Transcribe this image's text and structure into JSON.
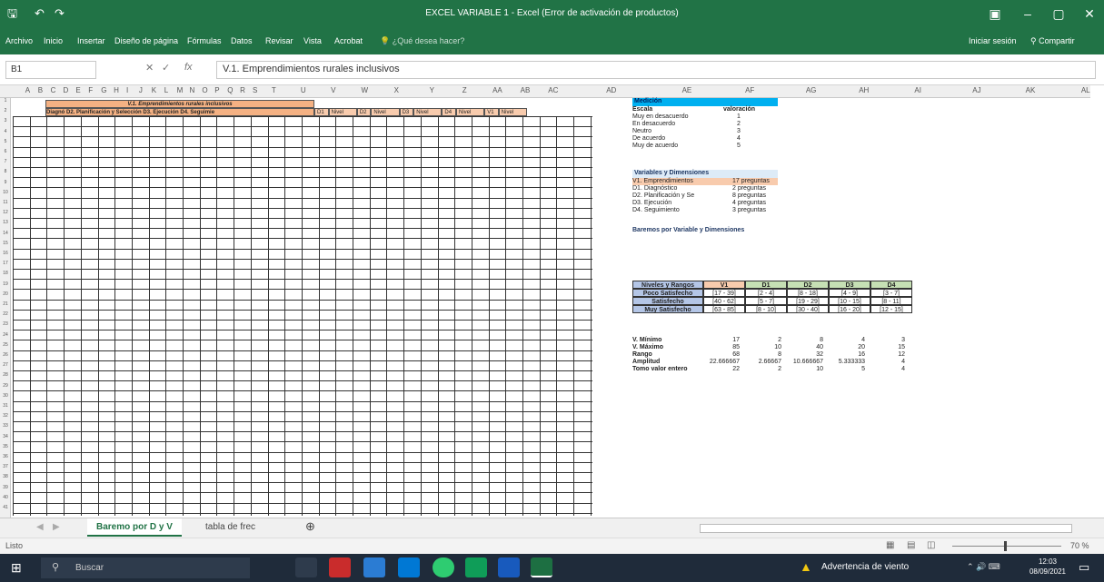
{
  "window": {
    "title": "EXCEL VARIABLE 1 - Excel (Error de activación de productos)"
  },
  "ribbon": {
    "tabs": [
      "Archivo",
      "Inicio",
      "Insertar",
      "Diseño de página",
      "Fórmulas",
      "Datos",
      "Revisar",
      "Vista",
      "Acrobat"
    ],
    "tell_me": "¿Qué desea hacer?",
    "signin": "Iniciar sesión",
    "share": "Compartir"
  },
  "formula_bar": {
    "name_box": "B1",
    "fx": "fx",
    "value": "V.1. Emprendimientos rurales inclusivos"
  },
  "columns": [
    "A",
    "B",
    "C",
    "D",
    "E",
    "F",
    "G",
    "H",
    "I",
    "J",
    "K",
    "L",
    "M",
    "N",
    "O",
    "P",
    "Q",
    "R",
    "S",
    "T",
    "U",
    "V",
    "W",
    "X",
    "Y",
    "Z",
    "AA",
    "AB",
    "AC",
    "AD",
    "AE",
    "AF",
    "AG",
    "AH",
    "AI",
    "AJ",
    "AK",
    "AL"
  ],
  "sheet": {
    "title_row": "V.1. Emprendimientos rurales inclusivos",
    "dimension_row": "Diagnó D2. Planificación y Selección D3. Ejecución D4. Seguimie",
    "right_headers": [
      "D1",
      "Nivel",
      "D2",
      "Nivel",
      "D3",
      "Nivel",
      "D4",
      "Nivel",
      "V1",
      "Nivel"
    ]
  },
  "medicion": {
    "title": "Medición",
    "header_left": "Escala",
    "header_right": "valoración",
    "rows": [
      {
        "label": "Muy en desacuerdo",
        "value": "1"
      },
      {
        "label": "En desacuerdo",
        "value": "2"
      },
      {
        "label": "Neutro",
        "value": "3"
      },
      {
        "label": "De acuerdo",
        "value": "4"
      },
      {
        "label": "Muy de acuerdo",
        "value": "5"
      }
    ]
  },
  "variables": {
    "title": "Variables y Dimensiones",
    "rows": [
      {
        "label": "V1. Emprendimientos",
        "value": "17 preguntas"
      },
      {
        "label": "D1. Diagnóstico",
        "value": "2 preguntas"
      },
      {
        "label": "D2. Planificación y Se",
        "value": "8 preguntas"
      },
      {
        "label": "D3. Ejecución",
        "value": "4 preguntas"
      },
      {
        "label": "D4. Seguimiento",
        "value": "3 preguntas"
      }
    ]
  },
  "baremos": {
    "title": "Baremos por Variable y Dimensiones",
    "headers": [
      "Niveles y Rangos",
      "V1",
      "D1",
      "D2",
      "D3",
      "D4"
    ],
    "rows": [
      {
        "label": "Poco Satisfecho",
        "cells": [
          "[17 - 39]",
          "[2 - 4]",
          "[8 - 18]",
          "[4 - 9]",
          "[3 - 7]"
        ]
      },
      {
        "label": "Satisfecho",
        "cells": [
          "[40 - 62]",
          "[5 - 7]",
          "[19 - 29]",
          "[10 - 15]",
          "[8 - 11]"
        ]
      },
      {
        "label": "Muy Satisfecho",
        "cells": [
          "[63 - 85]",
          "[8 - 10]",
          "[30 - 40]",
          "[16 - 20]",
          "[12 - 15]"
        ]
      }
    ]
  },
  "stats": {
    "rows": [
      {
        "label": "V. Mínimo",
        "cells": [
          "17",
          "2",
          "8",
          "4",
          "3"
        ]
      },
      {
        "label": "V. Máximo",
        "cells": [
          "85",
          "10",
          "40",
          "20",
          "15"
        ]
      },
      {
        "label": "Rango",
        "cells": [
          "68",
          "8",
          "32",
          "16",
          "12"
        ]
      },
      {
        "label": "Amplitud",
        "cells": [
          "22.666667",
          "2.66667",
          "10.666667",
          "5.333333",
          "4"
        ]
      },
      {
        "label": "Tomo valor entero",
        "cells": [
          "22",
          "2",
          "10",
          "5",
          "4"
        ]
      }
    ]
  },
  "sheet_tabs": [
    {
      "label": "Baremo por D y V",
      "active": true
    },
    {
      "label": "tabla de frec",
      "active": false
    }
  ],
  "status": {
    "left": "Listo",
    "zoom": "70 %"
  },
  "taskbar": {
    "search": "Buscar",
    "warning": "Advertencia de viento",
    "time": "12:03",
    "date": "08/09/2021"
  }
}
